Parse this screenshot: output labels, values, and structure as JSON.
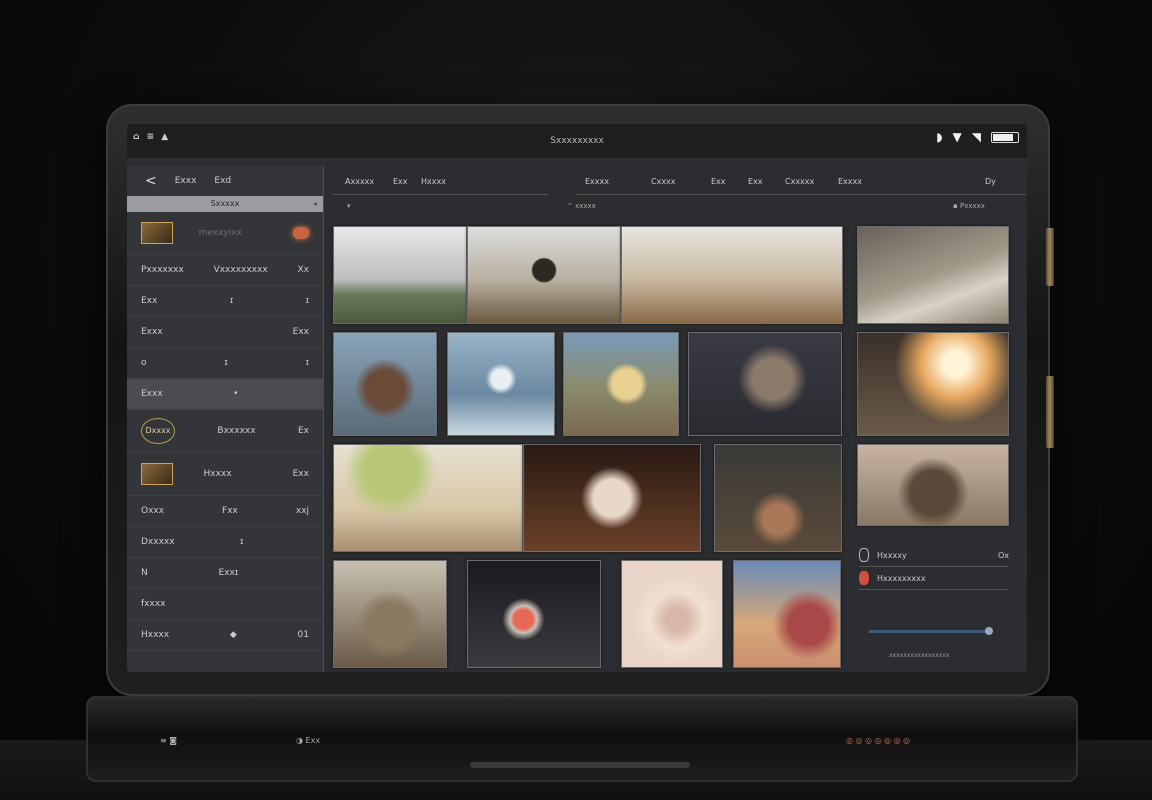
{
  "status": {
    "left_icons": "⌂ ≡ ▲",
    "title": "Sxxxxxxxxx",
    "right_icons": [
      "◗",
      "▼",
      "◥"
    ],
    "battery_level": 0.85
  },
  "left_panel": {
    "back_label": "<",
    "header_tabs": [
      "Exxx",
      "Exd"
    ],
    "bar_label": "Sxxxxx",
    "rows": [
      {
        "label": "mexxyixx",
        "right": "",
        "type": "thumb"
      },
      {
        "label": "Pxxxxxxx",
        "mid": "Vxxxxxxxxx",
        "right": "Xx"
      },
      {
        "label": "Exx",
        "mid": "ɪ",
        "right": "ɪ"
      },
      {
        "label": "Exxx",
        "mid": "",
        "right": "Exx"
      },
      {
        "label": "o",
        "mid": "ɪ",
        "right": "ɪ"
      },
      {
        "label": "Exxx",
        "mid": "•",
        "right": "",
        "selected": true
      },
      {
        "label": "Dxxxx",
        "mid": "Bxxxxxx",
        "right": "Ex",
        "type": "pill"
      },
      {
        "label": "Hxxxx",
        "mid": "",
        "right": "Exx",
        "type": "thumb2"
      },
      {
        "label": "Oxxx",
        "mid": "Fxx",
        "right": "xxj"
      },
      {
        "label": "Dxxxxx",
        "mid": "ɪ",
        "right": ""
      },
      {
        "label": "N",
        "mid": "Exxɪ",
        "right": ""
      },
      {
        "label": "fxxxx",
        "mid": "",
        "right": ""
      },
      {
        "label": "Hxxxx",
        "mid": "◆",
        "right": "01"
      }
    ]
  },
  "toolbar": {
    "left_items": [
      "Axxxxx",
      "Exx",
      "Hxxxx"
    ],
    "right_items": [
      "Exxxx",
      "Cxxxx",
      "Exx",
      "Exx",
      "Cxxxxx",
      "Exxxx"
    ],
    "end_item": "Dy",
    "sub_left": "▾",
    "sub_center": "⌃ xxxxx",
    "sub_right": "▪ Pxxxxx"
  },
  "right_panel": {
    "rows": [
      {
        "label": "Hxxxxy",
        "right": "Ox"
      },
      {
        "label": "Hxxxxxxxxx",
        "right": ""
      }
    ],
    "footer": "xxxxxxxxxxxxxxxxx"
  },
  "base": {
    "left": "≡ ◙",
    "mid": "◑ Exx",
    "right": "◎ ◎ ◎ ◎ ◎ ◎ ◎"
  }
}
